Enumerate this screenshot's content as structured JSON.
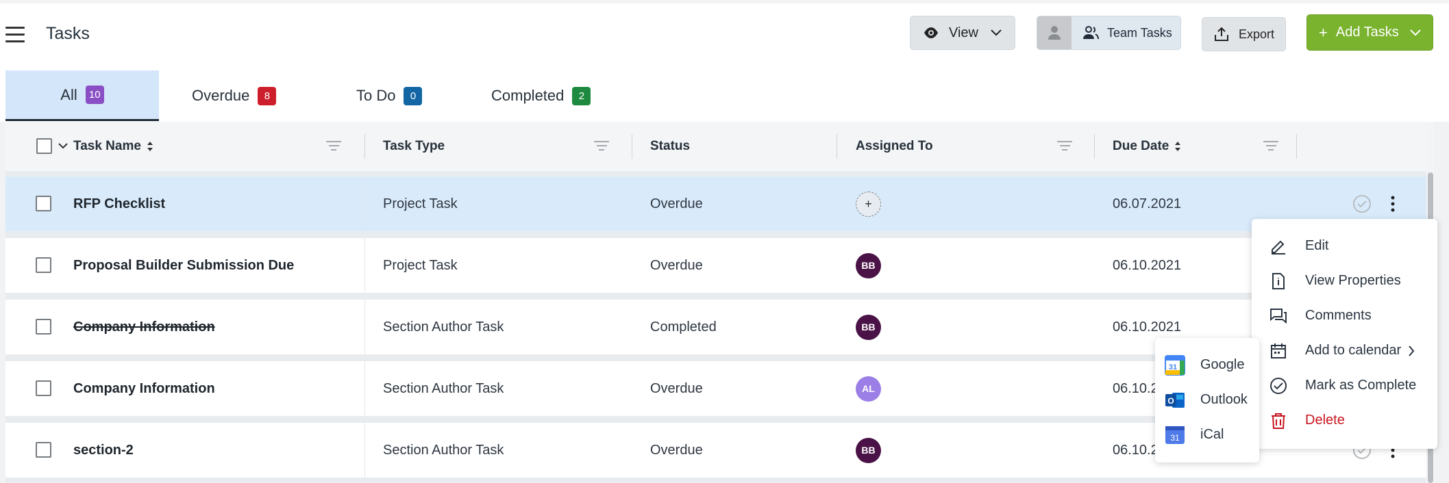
{
  "header": {
    "title": "Tasks",
    "view_label": "View",
    "team_label": "Team Tasks",
    "export_label": "Export",
    "add_label": "Add Tasks"
  },
  "tabs": [
    {
      "label": "All",
      "count": "10",
      "color": "#8a4fc5"
    },
    {
      "label": "Overdue",
      "count": "8",
      "color": "#cc1f2b"
    },
    {
      "label": "To Do",
      "count": "0",
      "color": "#1266a3"
    },
    {
      "label": "Completed",
      "count": "2",
      "color": "#1d8a3f"
    }
  ],
  "columns": {
    "task_name": "Task Name",
    "task_type": "Task Type",
    "status": "Status",
    "assigned_to": "Assigned To",
    "due_date": "Due Date"
  },
  "rows": [
    {
      "name": "RFP Checklist",
      "type": "Project Task",
      "status": "Overdue",
      "assignee": "+",
      "assignee_color": "",
      "due": "06.07.2021"
    },
    {
      "name": "Proposal Builder Submission Due",
      "type": "Project Task",
      "status": "Overdue",
      "assignee": "BB",
      "assignee_color": "#4a1246",
      "due": "06.10.2021"
    },
    {
      "name": "Company Information",
      "type": "Section Author Task",
      "status": "Completed",
      "assignee": "BB",
      "assignee_color": "#4a1246",
      "due": "06.10.2021"
    },
    {
      "name": "Company Information",
      "type": "Section Author Task",
      "status": "Overdue",
      "assignee": "AL",
      "assignee_color": "#9b7fe6",
      "due": "06.10.2"
    },
    {
      "name": "section-2",
      "type": "Section Author Task",
      "status": "Overdue",
      "assignee": "BB",
      "assignee_color": "#4a1246",
      "due": "06.10.2"
    }
  ],
  "context_menu": {
    "edit": "Edit",
    "view_properties": "View Properties",
    "comments": "Comments",
    "add_to_calendar": "Add to calendar",
    "mark_complete": "Mark as Complete",
    "delete": "Delete"
  },
  "calendar_menu": {
    "google": "Google",
    "outlook": "Outlook",
    "ical": "iCal"
  }
}
